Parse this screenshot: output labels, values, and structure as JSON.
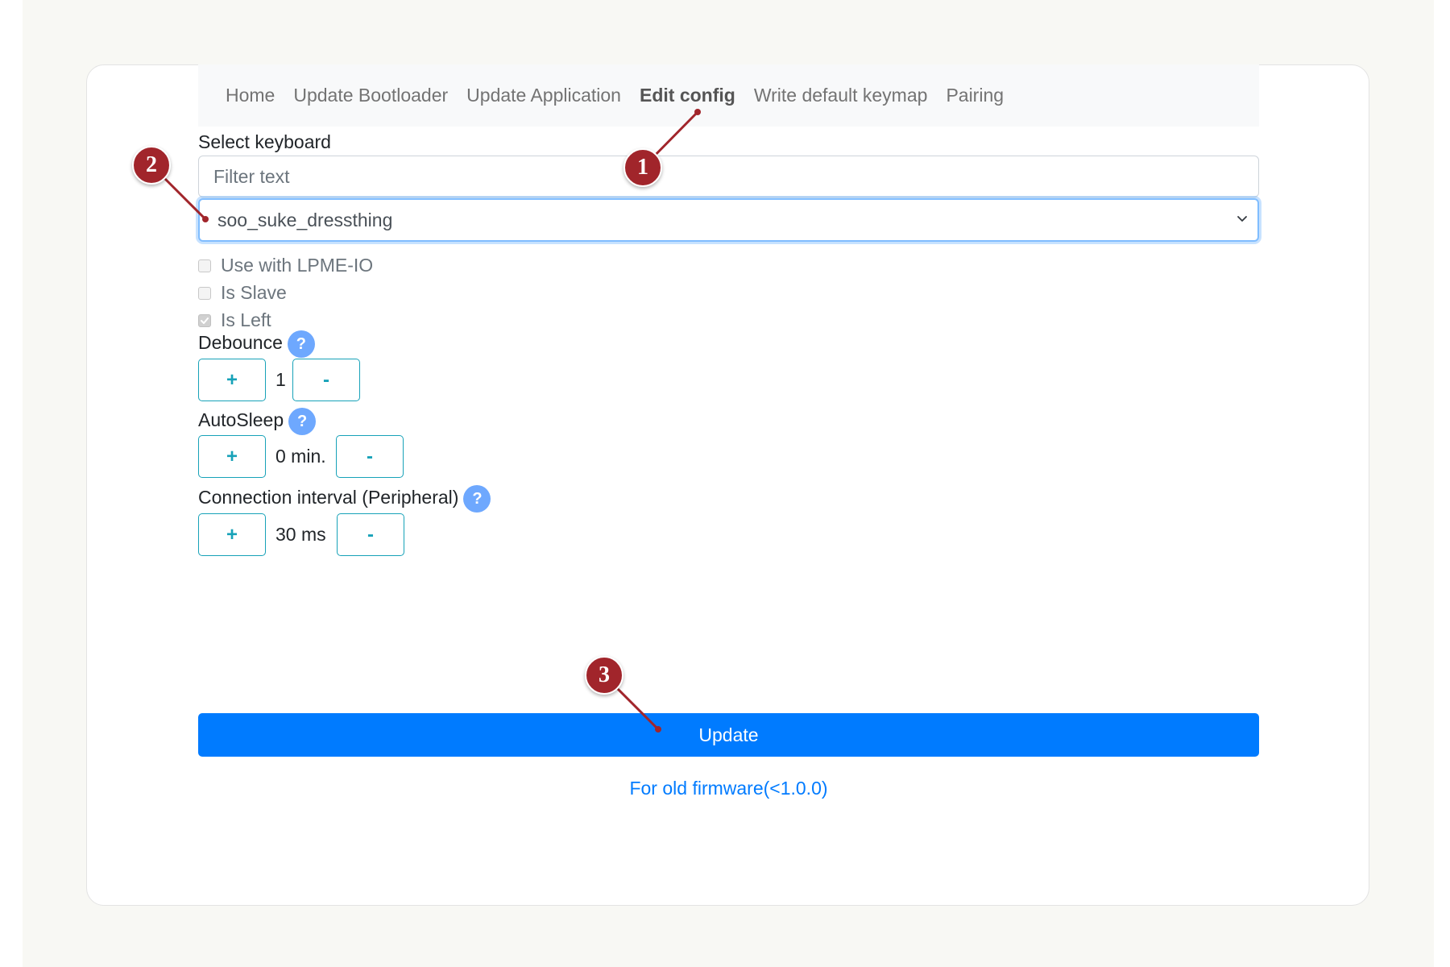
{
  "nav": {
    "items": [
      {
        "label": "Home",
        "active": false
      },
      {
        "label": "Update Bootloader",
        "active": false
      },
      {
        "label": "Update Application",
        "active": false
      },
      {
        "label": "Edit config",
        "active": true
      },
      {
        "label": "Write default keymap",
        "active": false
      },
      {
        "label": "Pairing",
        "active": false
      }
    ]
  },
  "keyboard": {
    "label": "Select keyboard",
    "filter_placeholder": "Filter text",
    "selected": "soo_suke_dressthing"
  },
  "options": [
    {
      "label": "Use with LPME-IO",
      "checked": false
    },
    {
      "label": "Is Slave",
      "checked": false
    },
    {
      "label": "Is Left",
      "checked": true
    }
  ],
  "debounce": {
    "label": "Debounce",
    "help": "?",
    "plus": "+",
    "value": "1",
    "minus": "-"
  },
  "autosleep": {
    "label": "AutoSleep",
    "help": "?",
    "plus": "+",
    "value": "0 min.",
    "minus": "-"
  },
  "conn_interval": {
    "label": "Connection interval (Peripheral)",
    "help": "?",
    "plus": "+",
    "value": "30 ms",
    "minus": "-"
  },
  "update_label": "Update",
  "old_firmware_link": "For old firmware(<1.0.0)",
  "callouts": [
    "1",
    "2",
    "3"
  ],
  "colors": {
    "primary": "#007bff",
    "info": "#17a2b8",
    "help": "#6ea8fe",
    "callout": "#a1252b"
  }
}
